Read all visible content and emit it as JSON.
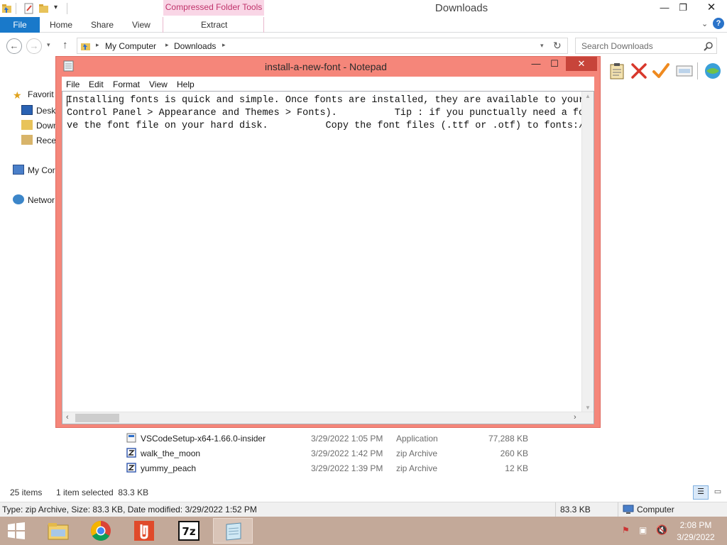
{
  "explorer": {
    "title": "Downloads",
    "contextual_tab": "Compressed Folder Tools",
    "ribbon_tabs": {
      "file": "File",
      "home": "Home",
      "share": "Share",
      "view": "View",
      "extract": "Extract"
    },
    "breadcrumb": [
      "My Computer",
      "Downloads"
    ],
    "search_placeholder": "Search Downloads",
    "nav": {
      "favorites": "Favorit",
      "desktop": "Deskt",
      "downloads": "Down",
      "recent": "Recer",
      "computer": "My Cor",
      "network": "Networ"
    },
    "files": [
      {
        "name": "VSCodeSetup-x64-1.66.0-insider",
        "date": "3/29/2022 1:05 PM",
        "type": "Application",
        "size": "77,288 KB",
        "icon": "vscode-installer-icon"
      },
      {
        "name": "walk_the_moon",
        "date": "3/29/2022 1:42 PM",
        "type": "zip Archive",
        "size": "260 KB",
        "icon": "zip-archive-icon"
      },
      {
        "name": "yummy_peach",
        "date": "3/29/2022 1:39 PM",
        "type": "zip Archive",
        "size": "12 KB",
        "icon": "zip-archive-icon"
      }
    ],
    "status": {
      "item_count": "25 items",
      "selection": "1 item selected  83.3 KB",
      "details": "Type: zip Archive, Size: 83.3 KB, Date modified: 3/29/2022 1:52 PM",
      "size": "83.3 KB",
      "location": "Computer"
    }
  },
  "notepad": {
    "title": "install-a-new-font - Notepad",
    "menu": {
      "file": "File",
      "edit": "Edit",
      "format": "Format",
      "view": "View",
      "help": "Help"
    },
    "lines": [
      "Installing fonts is quick and simple. Once fonts are installed, they are available to your",
      "Control Panel > Appearance and Themes > Fonts).          Tip : if you punctually need a fon",
      "ve the font file on your hard disk.          Copy the font files (.ttf or .otf) to fonts:/."
    ]
  },
  "taskbar": {
    "time": "2:08 PM",
    "date": "3/29/2022",
    "apps": [
      "file-explorer-icon",
      "chrome-icon",
      "foxit-reader-icon",
      "7zip-icon",
      "notepad-icon"
    ]
  },
  "colors": {
    "accent": "#1979ca",
    "context_tab_bg": "#f9d6e6",
    "context_tab_text": "#c0336b",
    "notepad_frame": "#f5867a",
    "taskbar": "#c3a999"
  }
}
